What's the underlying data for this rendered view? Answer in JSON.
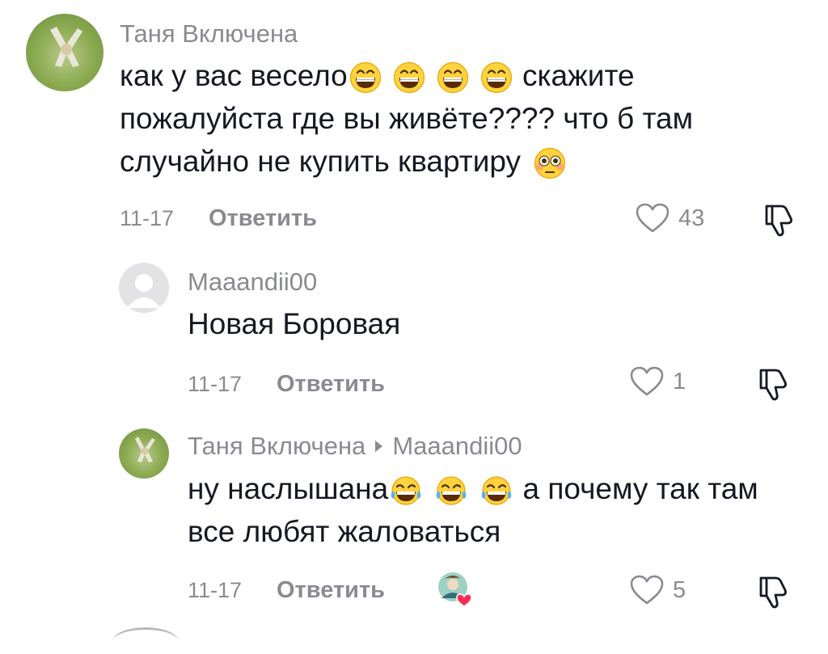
{
  "comments": [
    {
      "author": "Таня Включена",
      "text_parts": [
        "как у вас весело",
        " скажите пожалуйста где вы живёте???? что б там случайно не купить квартиру "
      ],
      "date": "11-17",
      "reply_label": "Ответить",
      "likes": "43"
    },
    {
      "author": "Maaandii00",
      "text": "Новая Боровая",
      "date": "11-17",
      "reply_label": "Ответить",
      "likes": "1"
    },
    {
      "author": "Таня Включена",
      "reply_to": "Maaandii00",
      "text_parts": [
        "ну наслышана",
        " а почему так там все любят жаловаться"
      ],
      "date": "11-17",
      "reply_label": "Ответить",
      "likes": "5"
    }
  ],
  "icons": {
    "like": "heart-outline-icon",
    "dislike": "thumbs-down-icon",
    "grinning": "grinning-face-emoji",
    "flushed": "flushed-face-emoji",
    "tears_of_joy": "face-with-tears-of-joy-emoji",
    "liked_by_creator": "creator-liked-badge"
  },
  "colors": {
    "text": "#161823",
    "muted": "#8a8b91",
    "heart": "#fe2c55"
  }
}
